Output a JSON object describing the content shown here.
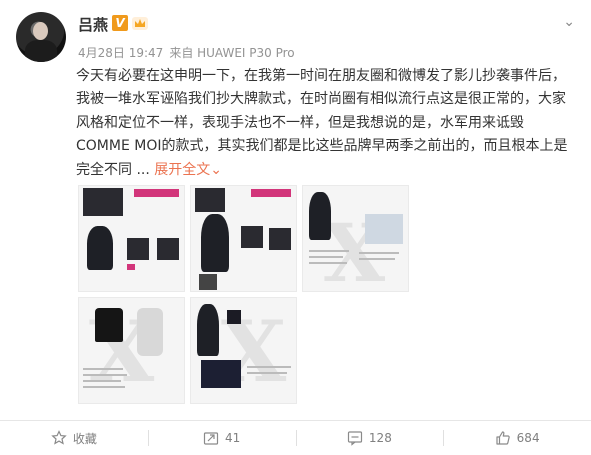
{
  "post": {
    "author": "吕燕",
    "vip_badge": "V",
    "timestamp": "4月28日 19:47",
    "source": "来自 HUAWEI P30 Pro",
    "text": "今天有必要在这申明一下，在我第一时间在朋友圈和微博发了影儿抄袭事件后，我被一堆水军诬陷我们抄大牌款式，在时尚圈有相似流行点这是很正常的，大家风格和定位不一样，表现手法也不一样，但是我想说的是，水军用来诋毁COMME MOI的款式，其实我们都是比这些品牌早两季之前出的，而且根本上是完全不同 ...",
    "expand_label": "展开全文",
    "expand_icon": "chevron-down-icon"
  },
  "actions": {
    "favorite_label": "收藏",
    "repost_count": "41",
    "comment_count": "128",
    "like_count": "684"
  },
  "colors": {
    "accent": "#eb7350",
    "vip": "#f09a1c",
    "meta": "#939393"
  }
}
